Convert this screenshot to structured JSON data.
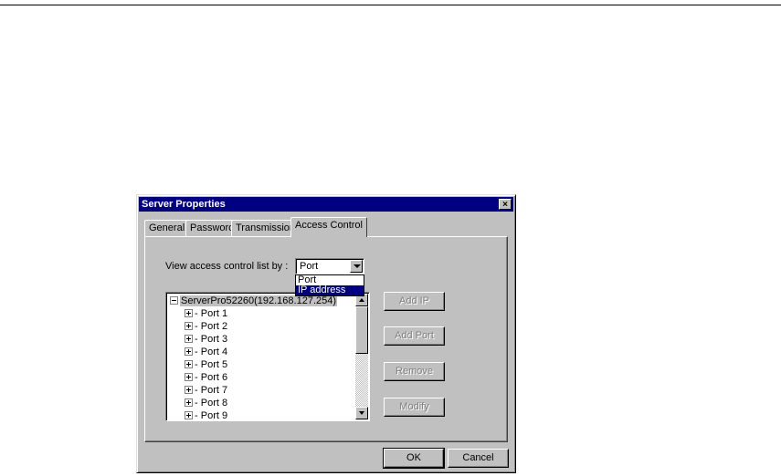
{
  "dialog": {
    "title": "Server Properties",
    "close_symbol": "×"
  },
  "tabs": [
    {
      "label": "General",
      "active": false
    },
    {
      "label": "Password",
      "active": false
    },
    {
      "label": "Transmission",
      "active": false
    },
    {
      "label": "Access Control",
      "active": true
    }
  ],
  "access_control": {
    "view_label": "View access control list by :",
    "view_selected": "Port",
    "view_options": [
      "Port",
      "IP address"
    ],
    "highlighted_option": "IP address",
    "tree": {
      "root": "ServerPro52260(192.168.127.254)",
      "nodes": [
        "Port 1",
        "Port 2",
        "Port 3",
        "Port 4",
        "Port 5",
        "Port 6",
        "Port 7",
        "Port 8",
        "Port 9"
      ]
    },
    "buttons": {
      "add_ip": "Add IP",
      "add_port": "Add Port",
      "remove": "Remove",
      "modify": "Modify"
    }
  },
  "footer": {
    "ok": "OK",
    "cancel": "Cancel"
  },
  "icons": {
    "collapse": "minus-box-icon",
    "expand": "plus-box-icon",
    "dropdown": "chevron-down-icon",
    "close": "close-icon"
  },
  "colors": {
    "title_bar": "#000080",
    "dialog_face": "#c0c0c0",
    "selection": "#000080"
  }
}
